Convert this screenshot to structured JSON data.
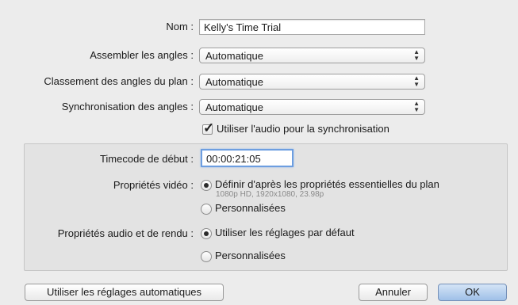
{
  "form": {
    "name": {
      "label": "Nom :",
      "value": "Kelly's Time Trial"
    },
    "assemble": {
      "label": "Assembler les angles :",
      "value": "Automatique"
    },
    "ordering": {
      "label": "Classement des angles du plan :",
      "value": "Automatique"
    },
    "sync": {
      "label": "Synchronisation des angles :",
      "value": "Automatique"
    },
    "use_audio": {
      "label": "Utiliser l'audio pour la synchronisation",
      "checked": true
    }
  },
  "group": {
    "timecode": {
      "label": "Timecode de début :",
      "value": "00:00:21:05"
    },
    "video": {
      "label": "Propriétés vidéo :",
      "option_clip": "Définir d'après les propriétés essentielles du plan",
      "option_clip_details": "1080p HD, 1920x1080, 23.98p",
      "option_custom": "Personnalisées",
      "selected": "option_clip"
    },
    "audio": {
      "label": "Propriétés audio et de rendu :",
      "option_default": "Utiliser les réglages par défaut",
      "option_custom": "Personnalisées",
      "selected": "option_default"
    }
  },
  "buttons": {
    "auto_settings": "Utiliser les réglages automatiques",
    "cancel": "Annuler",
    "ok": "OK"
  },
  "icons": {
    "popup_arrows": "updown-arrows-icon",
    "checkmark": "checkmark-icon"
  }
}
